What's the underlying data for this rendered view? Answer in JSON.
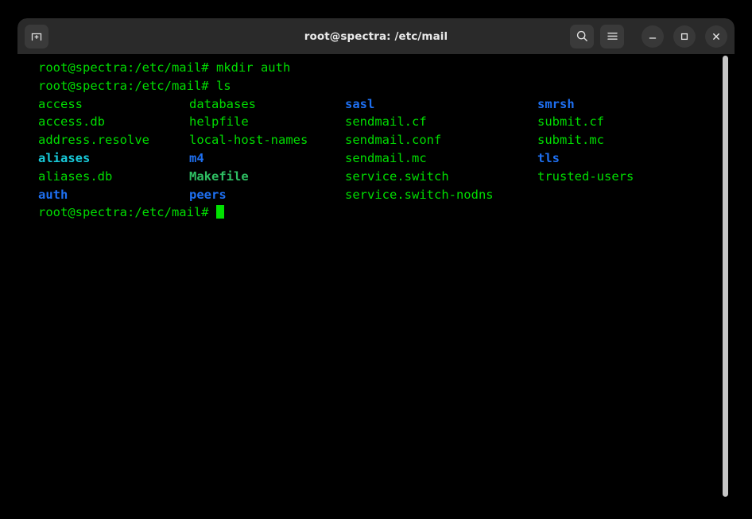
{
  "window": {
    "title": "root@spectra: /etc/mail",
    "new_tab_label": "new-tab",
    "search_label": "search",
    "menu_label": "menu",
    "minimize_label": "minimize",
    "maximize_label": "maximize",
    "close_label": "close"
  },
  "terminal": {
    "prompt": "root@spectra:/etc/mail#",
    "lines": [
      {
        "type": "command",
        "prompt": "root@spectra:/etc/mail#",
        "command": " mkdir auth"
      },
      {
        "type": "command",
        "prompt": "root@spectra:/etc/mail#",
        "command": " ls"
      }
    ],
    "ls_columns": [
      {
        "entries": [
          {
            "name": "access",
            "kind": "file"
          },
          {
            "name": "access.db",
            "kind": "file"
          },
          {
            "name": "address.resolve",
            "kind": "file"
          },
          {
            "name": "aliases",
            "kind": "link"
          },
          {
            "name": "aliases.db",
            "kind": "file"
          },
          {
            "name": "auth",
            "kind": "dir"
          }
        ]
      },
      {
        "entries": [
          {
            "name": "databases",
            "kind": "file"
          },
          {
            "name": "helpfile",
            "kind": "file"
          },
          {
            "name": "local-host-names",
            "kind": "file"
          },
          {
            "name": "m4",
            "kind": "dir"
          },
          {
            "name": "Makefile",
            "kind": "exec"
          },
          {
            "name": "peers",
            "kind": "dir"
          }
        ]
      },
      {
        "entries": [
          {
            "name": "sasl",
            "kind": "dir"
          },
          {
            "name": "sendmail.cf",
            "kind": "file"
          },
          {
            "name": "sendmail.conf",
            "kind": "file"
          },
          {
            "name": "sendmail.mc",
            "kind": "file"
          },
          {
            "name": "service.switch",
            "kind": "file"
          },
          {
            "name": "service.switch-nodns",
            "kind": "file"
          }
        ]
      },
      {
        "entries": [
          {
            "name": "smrsh",
            "kind": "dir"
          },
          {
            "name": "submit.cf",
            "kind": "file"
          },
          {
            "name": "submit.mc",
            "kind": "file"
          },
          {
            "name": "tls",
            "kind": "dir"
          },
          {
            "name": "trusted-users",
            "kind": "file"
          }
        ]
      }
    ],
    "final_prompt": "root@spectra:/etc/mail#",
    "cursor": "block"
  },
  "colors": {
    "background": "#000000",
    "header": "#2a2a2a",
    "text_green": "#00dd00",
    "dir_blue": "#1e6ff0",
    "link_cyan": "#17c8d8",
    "exec_green": "#2ebf63",
    "scrollbar": "#c6c6c6"
  }
}
